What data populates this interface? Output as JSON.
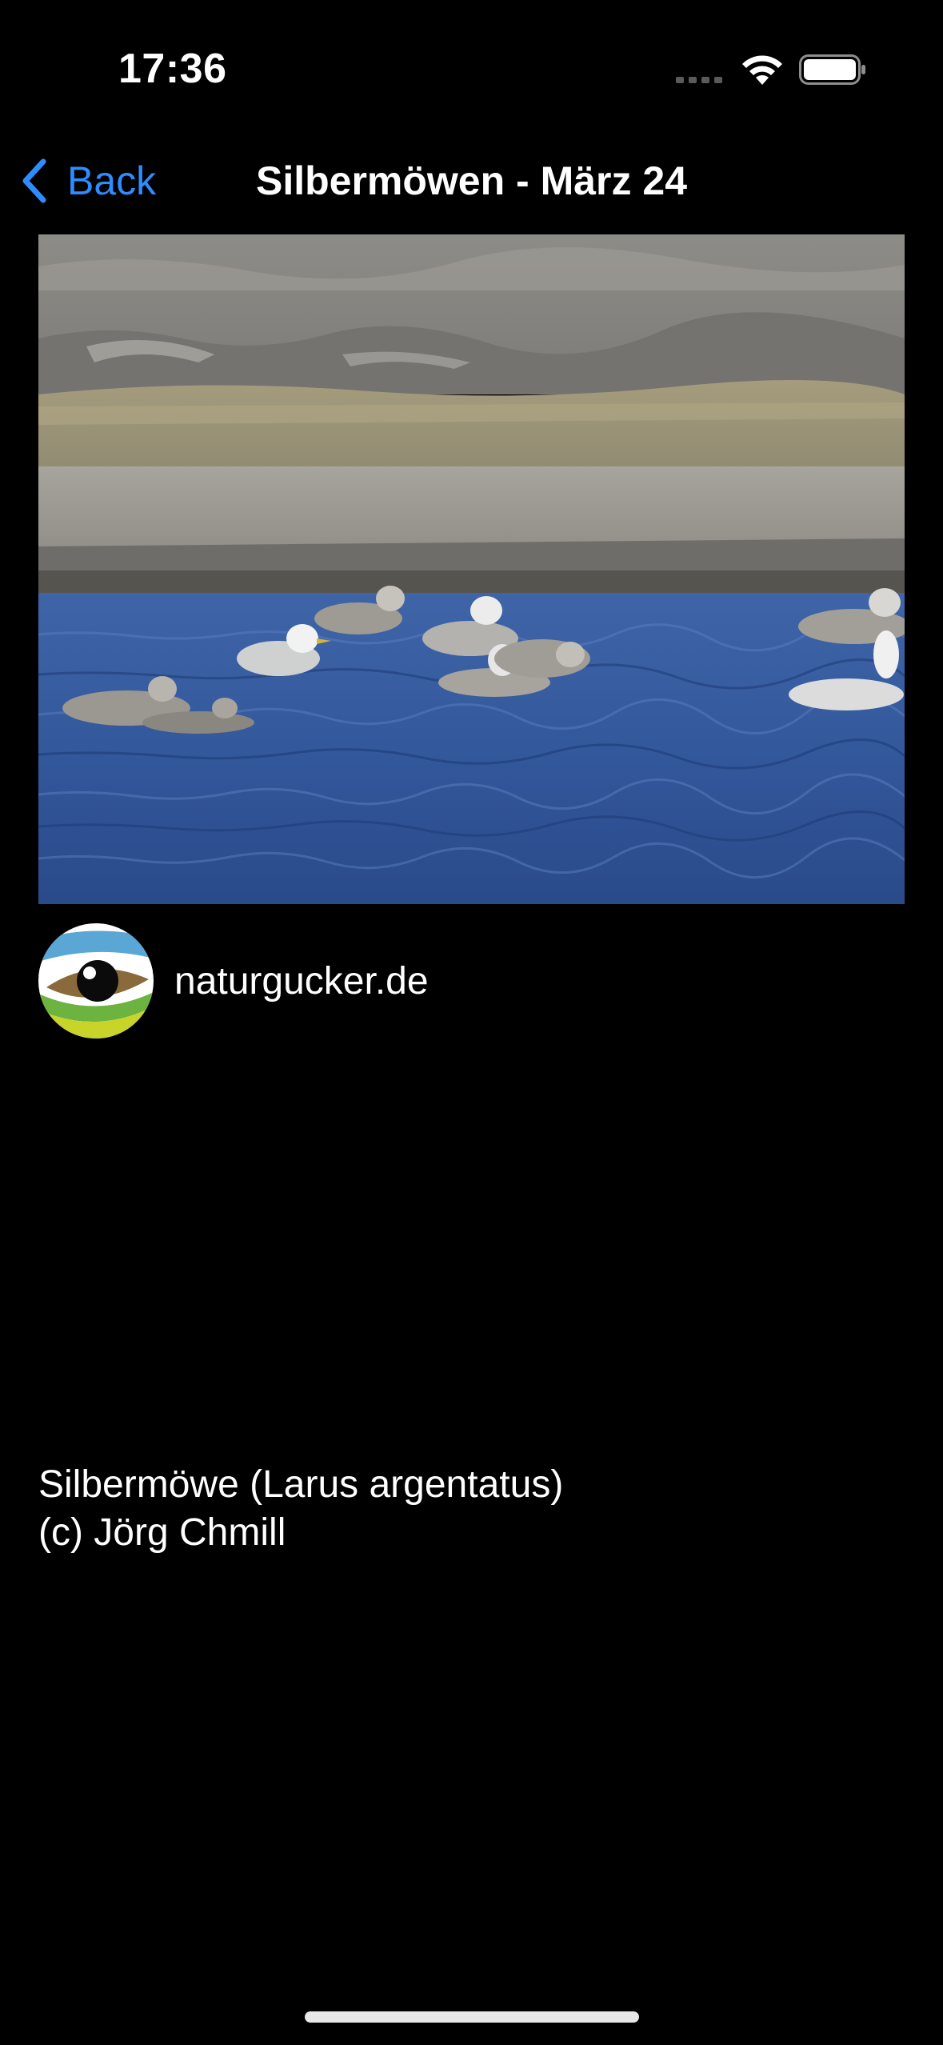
{
  "status_bar": {
    "time": "17:36",
    "icons": [
      "cellular-signal-icon",
      "wifi-icon",
      "battery-icon"
    ]
  },
  "nav": {
    "back_label": "Back",
    "title": "Silbermöwen - März 24"
  },
  "photo": {
    "description_icon": "gull-photo"
  },
  "source": {
    "name": "naturgucker.de",
    "logo_icon": "naturgucker-logo-icon"
  },
  "caption": {
    "line1": "Silbermöwe (Larus argentatus)",
    "line2": "(c) Jörg Chmill"
  },
  "colors": {
    "background": "#000000",
    "accent": "#2f8cff",
    "text": "#ffffff"
  }
}
